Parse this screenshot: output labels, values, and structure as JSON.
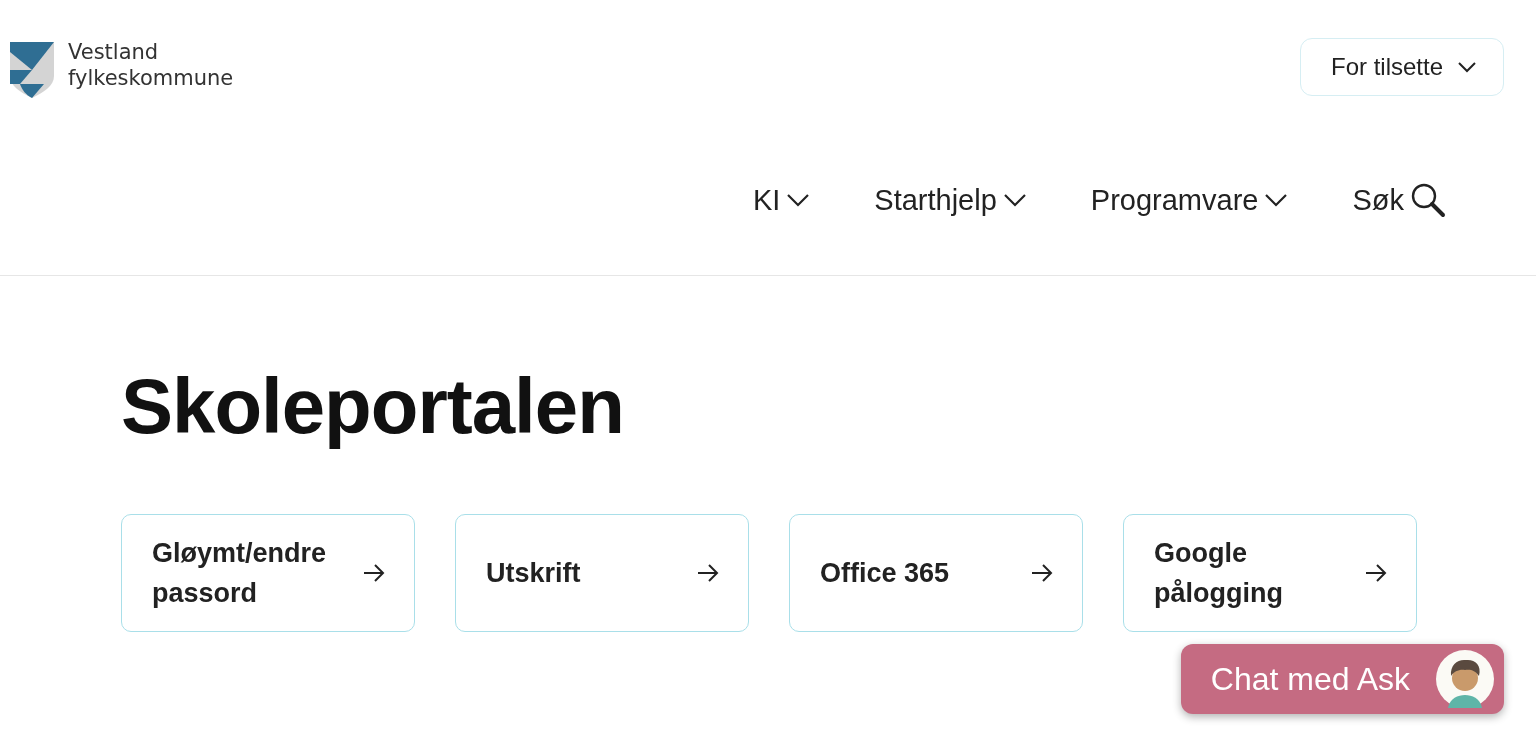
{
  "header": {
    "logo_line_1": "Vestland",
    "logo_line_2": "fylkeskommune",
    "staff_menu": {
      "label": "For tilsette",
      "expanded": false
    }
  },
  "nav": [
    {
      "label": "KI",
      "kind": "dropdown"
    },
    {
      "label": "Starthjelp",
      "kind": "dropdown"
    },
    {
      "label": "Programvare",
      "kind": "dropdown"
    },
    {
      "label": "Søk",
      "kind": "search"
    }
  ],
  "title": "Skoleportalen",
  "cards": [
    {
      "label": "Gløymt/endre passord"
    },
    {
      "label": "Utskrift"
    },
    {
      "label": "Office 365"
    },
    {
      "label": "Google pålogging"
    }
  ],
  "chat_button": {
    "label": "Chat med Ask"
  }
}
